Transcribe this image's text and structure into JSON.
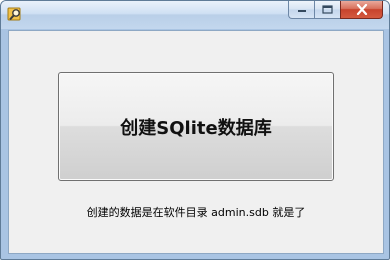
{
  "window": {
    "icon": "folder-search-icon",
    "controls": {
      "minimize_icon": "minimize-icon",
      "maximize_icon": "maximize-icon",
      "close_icon": "close-icon"
    }
  },
  "main": {
    "create_db_button_label": "创建SQlite数据库",
    "info_text": "创建的数据是在软件目录 admin.sdb 就是了"
  },
  "colors": {
    "titlebar": "#c3d7ee",
    "close_button": "#c7432d",
    "client_background": "#f0f0f0"
  }
}
